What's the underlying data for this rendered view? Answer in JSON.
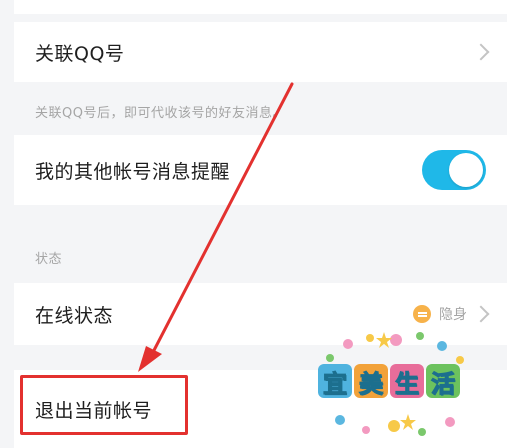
{
  "settings": {
    "link_qq_label": "关联QQ号",
    "link_qq_hint": "关联QQ号后，即可代收该号的好友消息。",
    "notify_label": "我的其他帐号消息提醒",
    "notify_toggle_on": true,
    "section_status_title": "状态",
    "online_status_label": "在线状态",
    "online_status_value": "隐身",
    "logout_label": "退出当前帐号"
  },
  "watermark": {
    "chars": [
      "宜",
      "美",
      "生",
      "活"
    ]
  },
  "colors": {
    "toggle_on": "#1fb8e8",
    "annotation_red": "#e3312f",
    "stealth_icon": "#f7b24a"
  },
  "icons": {
    "row_arrow": "chevron-right-icon",
    "status": "stealth-status-icon"
  }
}
